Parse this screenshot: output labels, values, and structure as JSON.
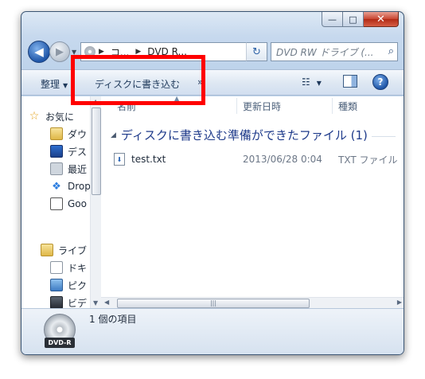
{
  "window": {
    "caption": {
      "minimize": "—",
      "maximize": "□",
      "close": "✕"
    }
  },
  "address": {
    "back": "◀",
    "forward": "▶",
    "crumbs": [
      "コ...",
      "DVD R..."
    ],
    "refresh": "↻",
    "search_placeholder": "DVD RW ドライブ (..."
  },
  "toolbar": {
    "organize_label": "整理",
    "burn_label": "ディスクに書き込む",
    "more_label": "»",
    "help_label": "?"
  },
  "sidebar": {
    "items": [
      {
        "label": "お気に",
        "icon": "star-icon"
      },
      {
        "label": "ダウ",
        "icon": "downloads-folder-icon"
      },
      {
        "label": "デス",
        "icon": "desktop-icon"
      },
      {
        "label": "最近",
        "icon": "recent-places-icon"
      },
      {
        "label": "Drop",
        "icon": "dropbox-icon"
      },
      {
        "label": "Goo",
        "icon": "google-drive-icon"
      },
      {
        "label": "ライブ",
        "icon": "libraries-icon"
      },
      {
        "label": "ドキ",
        "icon": "documents-icon"
      },
      {
        "label": "ピク",
        "icon": "pictures-icon"
      },
      {
        "label": "ビデ",
        "icon": "videos-icon"
      }
    ]
  },
  "columns": {
    "name": "名前",
    "date": "更新日時",
    "type": "種類"
  },
  "group": {
    "label": "ディスクに書き込む準備ができたファイル (1)"
  },
  "files": [
    {
      "name": "test.txt",
      "date": "2013/06/28 0:04",
      "type": "TXT ファイル"
    }
  ],
  "details": {
    "status": "1 個の項目",
    "drive_tag": "DVD-R"
  },
  "colors": {
    "highlight": "#ff0000",
    "group_text": "#1e3a8a"
  }
}
